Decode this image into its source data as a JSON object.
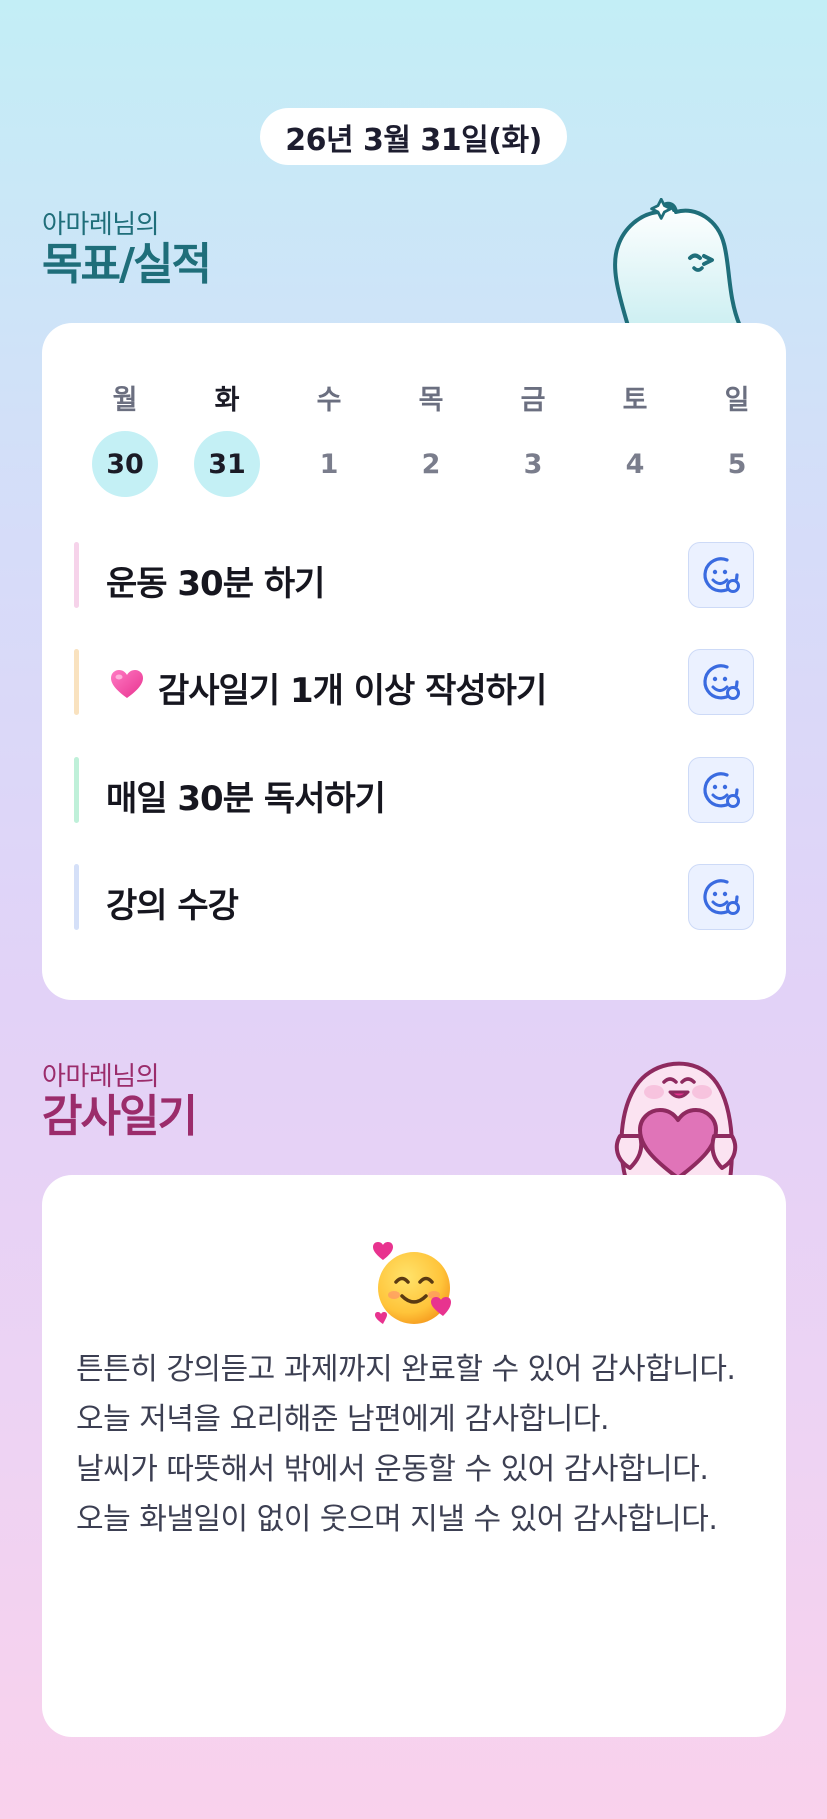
{
  "header": {
    "date_label": "26년 3월 31일(화)"
  },
  "goals_section": {
    "subtitle": "아마레님의",
    "title": "목표/실적"
  },
  "week": {
    "days": [
      {
        "weekday": "월",
        "date": "30",
        "active": true
      },
      {
        "weekday": "화",
        "date": "31",
        "active": true,
        "today": true
      },
      {
        "weekday": "수",
        "date": "1",
        "active": false
      },
      {
        "weekday": "목",
        "date": "2",
        "active": false
      },
      {
        "weekday": "금",
        "date": "3",
        "active": false
      },
      {
        "weekday": "토",
        "date": "4",
        "active": false
      },
      {
        "weekday": "일",
        "date": "5",
        "active": false
      }
    ]
  },
  "goals": [
    {
      "label": "운동 30분 하기",
      "bar_color": "#f6d3ea",
      "heart": false
    },
    {
      "label": "감사일기 1개 이상 작성하기",
      "bar_color": "#f9e2bf",
      "heart": true
    },
    {
      "label": "매일 30분 독서하기",
      "bar_color": "#bff0d9",
      "heart": false
    },
    {
      "label": "강의 수강",
      "bar_color": "#d5e0f8",
      "heart": false
    }
  ],
  "gratitude_section": {
    "subtitle": "아마레님의",
    "title": "감사일기"
  },
  "gratitude": {
    "emoji": "smiling-face-with-hearts",
    "entries": [
      "튼튼히 강의듣고 과제까지 완료할 수 있어 감사합니다.",
      "오늘 저녁을 요리해준 남편에게 감사합니다.",
      "날씨가 따뜻해서 밖에서 운동할 수 있어 감사합니다.",
      "오늘 화낼일이 없이 웃으며 지낼 수 있어 감사합니다."
    ]
  },
  "colors": {
    "goal_title": "#1f6e7a",
    "gratitude_title": "#9b2c6b",
    "active_date": "#c4f0f5",
    "smile_icon": "#3a6be0"
  }
}
